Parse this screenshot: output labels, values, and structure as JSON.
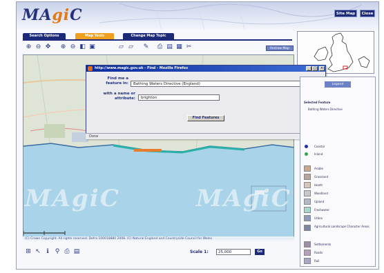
{
  "header": {
    "logo_prefix": "MA",
    "logo_accent": "gi",
    "logo_suffix": "C",
    "site_map": "Site Map",
    "close": "Close"
  },
  "tabs": {
    "search": "Search Options",
    "map_tools": "Map Tools",
    "change_topic": "Change Map Topic"
  },
  "toolbar": {
    "icons": [
      "zoom-in-icon",
      "zoom-out-icon",
      "pan-icon",
      "zoom-in-icon",
      "zoom-out-icon",
      "previous-view-icon",
      "full-extent-icon",
      "measure-icon",
      "ruler-icon",
      "identify-icon",
      "print-icon",
      "save-icon",
      "export-icon",
      "query-icon"
    ],
    "redraw_label": "Redraw Map"
  },
  "popup": {
    "title": "http://www.magic.gov.uk - Find - Mozilla Firefox",
    "feature_label_line1": "Find me a",
    "feature_label_line2": "feature in:",
    "feature_value": "Bathing Waters Directive (England)",
    "attribute_label_line1": "with a name or",
    "attribute_label_line2": "attribute:",
    "attribute_value": "brighton",
    "find_button": "Find Features",
    "status": "Done"
  },
  "map": {
    "watermark": "MAgiC",
    "copyright": "(C) Crown Copyright. All rights reserved. Defra 100018880 2008. (C) Natural England and Countryside Council for Wales"
  },
  "legend": {
    "tab_label": "Legend",
    "heading": "Selected Feature",
    "items": [
      {
        "label": "Bathing Waters Directive",
        "color": ""
      },
      {
        "label": "Coastal",
        "color": "#1f2fa8"
      },
      {
        "label": "Inland",
        "color": "#2fa848"
      },
      {
        "label": "Arable",
        "color": "#c9a890"
      },
      {
        "label": "Grassland",
        "color": "#b8a49a"
      },
      {
        "label": "Heath",
        "color": "#d6c7b6"
      },
      {
        "label": "Woodland",
        "color": "#c9c9c9"
      },
      {
        "label": "Upland",
        "color": "#b3b8c6"
      },
      {
        "label": "Freshwater",
        "color": "#a8d8d0"
      },
      {
        "label": "Urban",
        "color": "#8e9cb8"
      },
      {
        "label": "Agricultural Landscape Character Areas",
        "color": "#7a86a6"
      },
      {
        "label": "Settlements",
        "color": "#9e8ea8"
      },
      {
        "label": "Roads",
        "color": "#b6a0b8"
      },
      {
        "label": "Rail",
        "color": "#a8a8c6"
      }
    ]
  },
  "bottom": {
    "icons": [
      "measure-icon",
      "pointer-icon",
      "info-icon",
      "zoom-icon",
      "print-icon",
      "save-icon"
    ],
    "scale_label": "Scale 1:",
    "scale_value": "25,000",
    "go": "Go"
  },
  "colors": {
    "brand_navy": "#1d2a7a",
    "accent_orange": "#f0a020",
    "sea_blue": "#a9d3e8"
  }
}
